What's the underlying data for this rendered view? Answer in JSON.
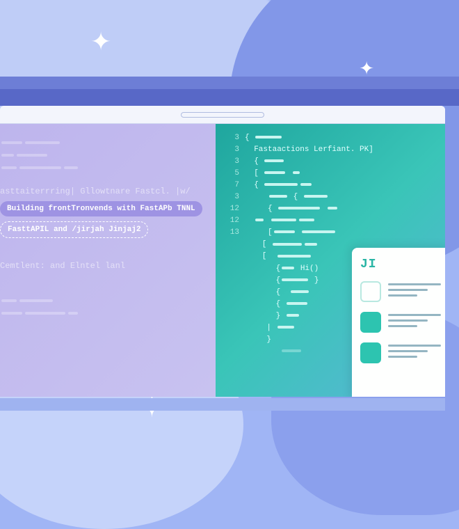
{
  "left": {
    "line1": "asttaiterrring| Gllowtnare Fastcl. |w/",
    "chip_main": "Building frontTronvends with FastAPb TNNL",
    "chip_sub": "FasttAPIL and /jirjah Jinjaj2",
    "line2": "Cemtlent: and Elntel lanl"
  },
  "right": {
    "header": "Fastaactions Lerfiant. PK]",
    "numbers": [
      "3",
      "3",
      "3",
      "5",
      "7",
      "3",
      "12",
      "12",
      "13"
    ],
    "call": "Hi()",
    "card_title": "JI"
  }
}
